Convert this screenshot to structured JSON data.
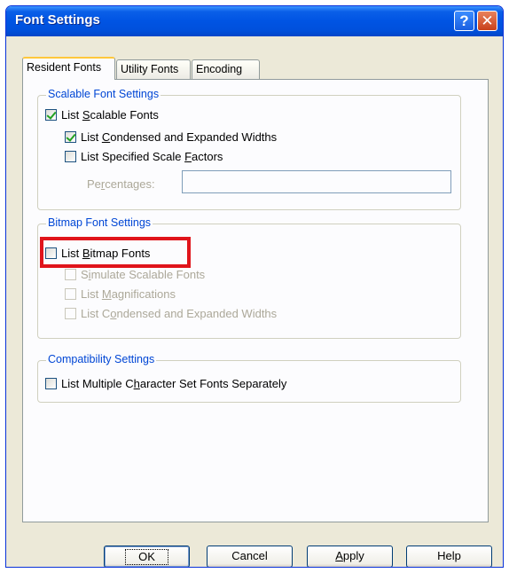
{
  "window": {
    "title": "Font Settings"
  },
  "titlebar_buttons": {
    "help": "?",
    "close": "✕"
  },
  "tabs": [
    {
      "label": "Resident Fonts",
      "active": true
    },
    {
      "label": "Utility Fonts",
      "active": false
    },
    {
      "label": "Encoding",
      "active": false
    }
  ],
  "scalable": {
    "group_label": "Scalable Font Settings",
    "list_scalable": {
      "pre": "List ",
      "mnemonic": "S",
      "post": "calable Fonts",
      "checked": true
    },
    "list_condensed": {
      "pre": "List ",
      "mnemonic": "C",
      "post": "ondensed and Expanded Widths",
      "checked": true
    },
    "list_specified": {
      "pre": "List Specified Scale ",
      "mnemonic": "F",
      "post": "actors",
      "checked": false
    },
    "percentages": {
      "pre": "Pe",
      "mnemonic": "r",
      "post": "centages:",
      "value": ""
    }
  },
  "bitmap": {
    "group_label": "Bitmap Font Settings",
    "list_bitmap": {
      "pre": "List ",
      "mnemonic": "B",
      "post": "itmap Fonts",
      "checked": false
    },
    "simulate": {
      "pre": "S",
      "mnemonic": "i",
      "post": "mulate Scalable Fonts",
      "checked": false
    },
    "magnifications": {
      "pre": "List ",
      "mnemonic": "M",
      "post": "agnifications",
      "checked": false
    },
    "condensed": {
      "pre": "List C",
      "mnemonic": "o",
      "post": "ndensed and Expanded Widths",
      "checked": false
    }
  },
  "compat": {
    "group_label": "Compatibility Settings",
    "multiple_charset": {
      "pre": "List Multiple C",
      "mnemonic": "h",
      "post": "aracter Set Fonts Separately",
      "checked": false
    }
  },
  "buttons": {
    "ok": "OK",
    "cancel": "Cancel",
    "apply": {
      "mnemonic": "A",
      "post": "pply"
    },
    "help": "Help"
  },
  "colors": {
    "title_bar": "#0054e3",
    "group_label": "#0046d5",
    "highlight": "#e0141b",
    "face": "#ece9d8"
  }
}
